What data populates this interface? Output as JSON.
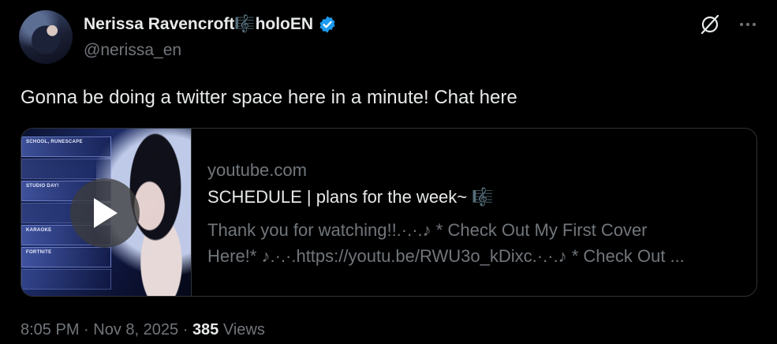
{
  "author": {
    "display_name": "Nerissa Ravencroft🎼holoEN",
    "handle": "@nerissa_en",
    "verified": true,
    "verified_color": "#1d9bf0"
  },
  "icons": {
    "grok": "grok-icon",
    "more": "more-icon",
    "verified": "verified-badge-icon",
    "play": "play-icon"
  },
  "tweet": {
    "text": "Gonna be doing a twitter space here in a minute! Chat here"
  },
  "card": {
    "domain": "youtube.com",
    "title": "SCHEDULE | plans for the week~ 🎼",
    "description": "Thank you for watching!!.·.·.♪ * Check Out My First Cover\nHere!* ♪.·.·.https://youtu.be/RWU3o_kDixc.·.·.♪ * Check Out ...",
    "thumbnail_panels": [
      "SCHOOL, RUNESCAPE",
      "STUDIO DAY!",
      "KARAOKE",
      "FORTNITE"
    ]
  },
  "footer": {
    "time": "8:05 PM",
    "separator": "·",
    "date": "Nov 8, 2025",
    "views_count": "385",
    "views_label": "Views"
  }
}
